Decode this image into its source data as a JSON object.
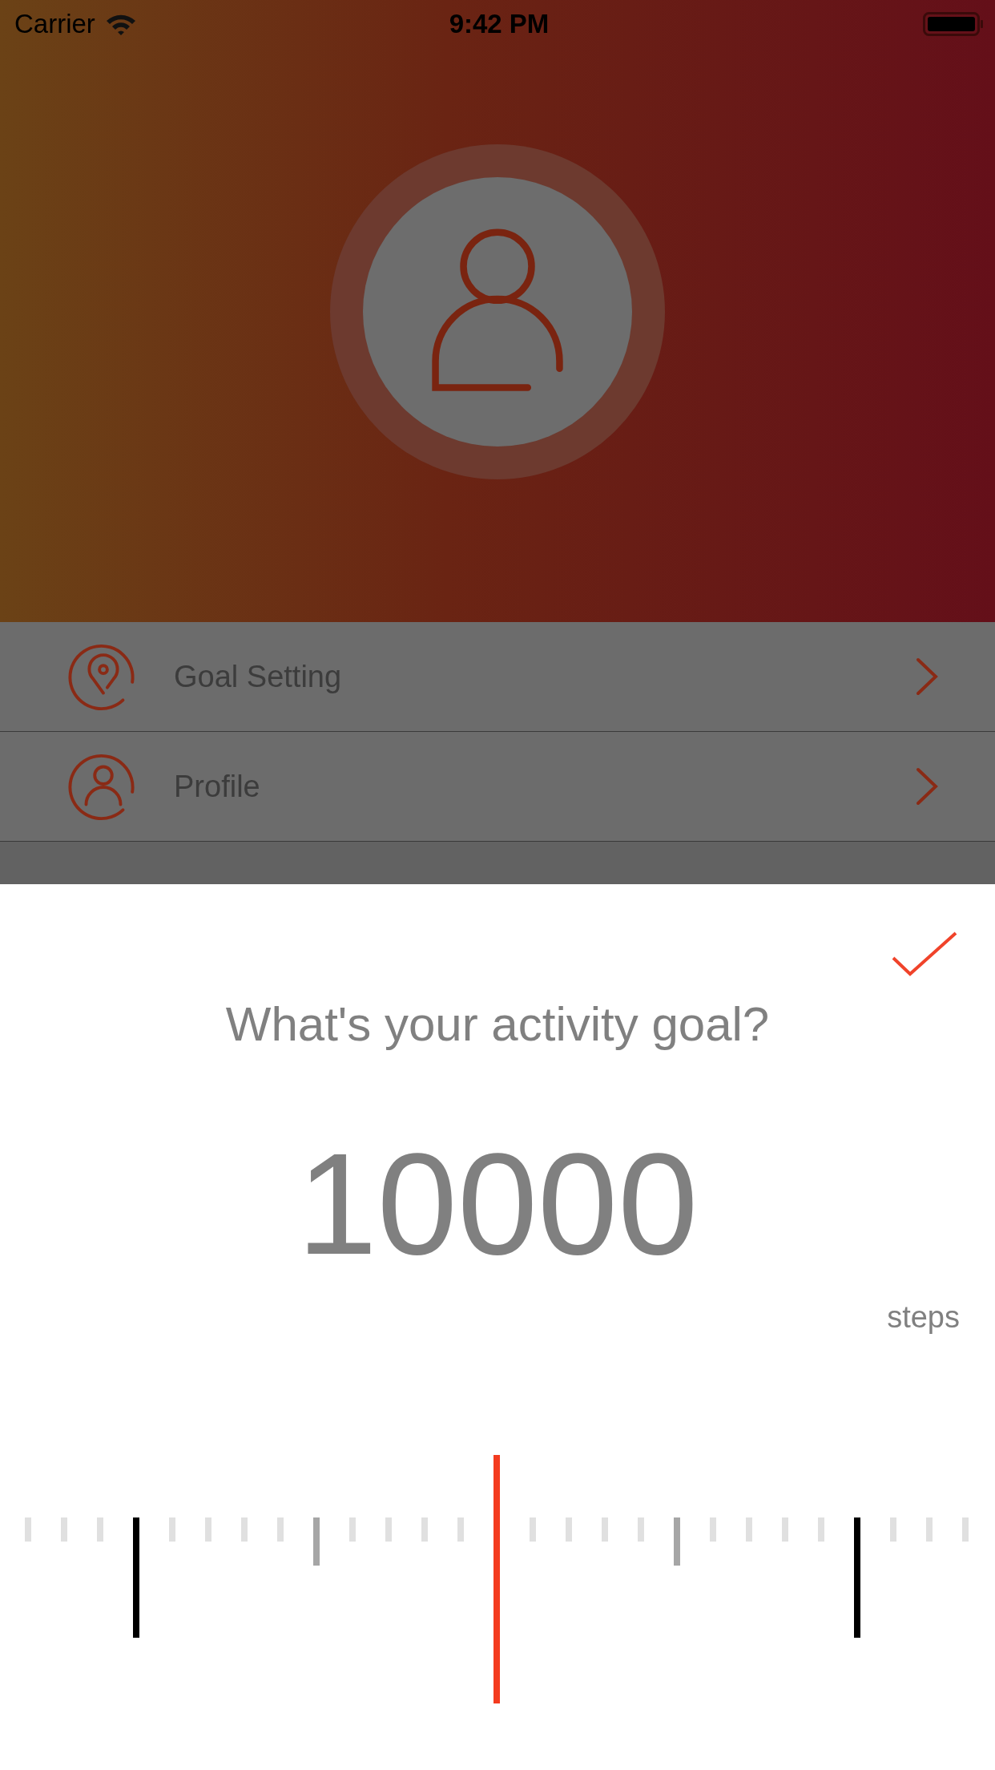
{
  "status_bar": {
    "carrier": "Carrier",
    "time": "9:42 PM"
  },
  "menu": [
    {
      "label": "Goal Setting",
      "kind": "pin"
    },
    {
      "label": "Profile",
      "kind": "person"
    }
  ],
  "goal_sheet": {
    "title": "What's your activity goal?",
    "value": "10000",
    "unit": "steps",
    "level": 0.5
  }
}
